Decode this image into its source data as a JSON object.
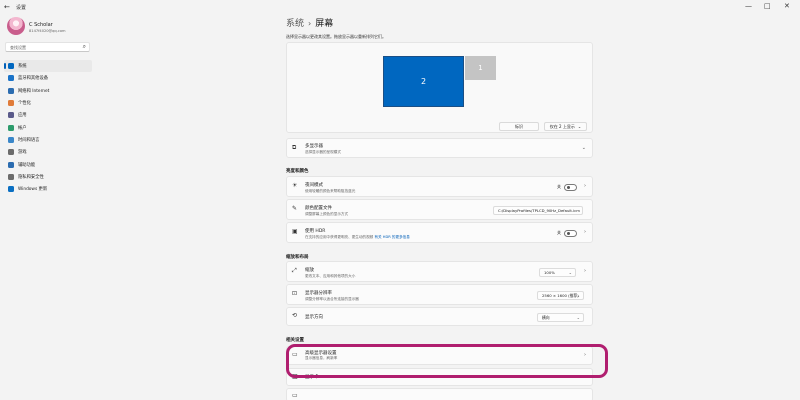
{
  "window": {
    "app_title": "设置",
    "back_glyph": "←",
    "minimize_glyph": "—",
    "maximize_glyph": "□",
    "close_glyph": "✕"
  },
  "profile": {
    "name": "C Scholar",
    "email": "8147f4020@qq.com"
  },
  "search": {
    "placeholder": "查找设置"
  },
  "nav": [
    {
      "label": "系统",
      "icon": "system-icon",
      "color": "#0067c0",
      "active": true
    },
    {
      "label": "蓝牙和其他设备",
      "icon": "bluetooth-icon",
      "color": "#1a73c8",
      "active": false
    },
    {
      "label": "网络和 Internet",
      "icon": "network-icon",
      "color": "#2b6cb0",
      "active": false
    },
    {
      "label": "个性化",
      "icon": "personalization-icon",
      "color": "#e07b39",
      "active": false
    },
    {
      "label": "应用",
      "icon": "apps-icon",
      "color": "#5a5a8a",
      "active": false
    },
    {
      "label": "帐户",
      "icon": "account-icon",
      "color": "#2d9c6c",
      "active": false
    },
    {
      "label": "时间和语言",
      "icon": "time-language-icon",
      "color": "#3a87c9",
      "active": false
    },
    {
      "label": "游戏",
      "icon": "gaming-icon",
      "color": "#6b6b6b",
      "active": false
    },
    {
      "label": "辅助功能",
      "icon": "accessibility-icon",
      "color": "#2b6cb0",
      "active": false
    },
    {
      "label": "隐私和安全性",
      "icon": "privacy-icon",
      "color": "#6b6b6b",
      "active": false
    },
    {
      "label": "Windows 更新",
      "icon": "windows-update-icon",
      "color": "#0a6fc2",
      "active": false
    }
  ],
  "breadcrumb": {
    "parent": "系统",
    "separator": "›",
    "current": "屏幕"
  },
  "description": "选择显示器以更改其设置。拖放显示器以重新排列它们。",
  "preview": {
    "monitor_2": "2",
    "monitor_1": "1",
    "identify_label": "标识",
    "duplicate_label": "仅在 2 上显示",
    "duplicate_arrow": "⌄"
  },
  "multi_display": {
    "title": "多显示器",
    "subtitle": "选择显示器的呈现模式",
    "chevron": "⌄"
  },
  "brightness_section": {
    "heading": "亮度和颜色",
    "night_light": {
      "title": "夜间模式",
      "subtitle": "使用较暖的颜色来帮助阻挡蓝光",
      "toggle_label": "关"
    },
    "color_profile": {
      "title": "颜色配置文件",
      "subtitle": "调整屏幕上颜色的显示方式",
      "value": "C:/DisplayProfiles/TPLCD_90Hz_Default.icm"
    },
    "hdr": {
      "title": "使用 HDR",
      "subtitle": "在支持的应用中获得更明亮、更生动的视频",
      "link": "有关 HDR 的更多信息",
      "toggle_label": "关"
    }
  },
  "scale_section": {
    "heading": "缩放和布局",
    "scale": {
      "title": "缩放",
      "subtitle": "更改文本、应用和其他项的大小",
      "value": "100%"
    },
    "resolution": {
      "title": "显示器分辨率",
      "subtitle": "调整分辨率以适合所连接的显示器",
      "value": "2560 × 1600 (推荐)"
    },
    "orientation": {
      "title": "显示方向",
      "value": "横向"
    }
  },
  "related_section": {
    "heading": "相关设置",
    "advanced": {
      "title": "高级显示器设置",
      "subtitle": "显示器信息，刷新率"
    },
    "graphics": {
      "title": "显示卡"
    }
  },
  "colors": {
    "accent": "#005fb8",
    "selected_monitor": "#0067c0",
    "highlight": "#b01e6f"
  }
}
